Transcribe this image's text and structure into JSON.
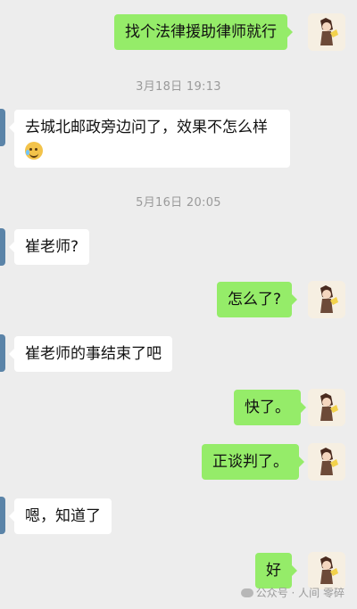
{
  "timestamps": [
    "3月18日 19:13",
    "5月16日 20:05"
  ],
  "messages": [
    {
      "side": "right",
      "text": "找个法律援助律师就行"
    },
    {
      "side": "left",
      "text_line1": "去城北邮政旁边问了，效果不怎么样",
      "emoji": "laughing-crying-emoji"
    },
    {
      "side": "left",
      "text": "崔老师?"
    },
    {
      "side": "right",
      "text": "怎么了?"
    },
    {
      "side": "left",
      "text": "崔老师的事结束了吧"
    },
    {
      "side": "right",
      "text": "快了。"
    },
    {
      "side": "right",
      "text": "正谈判了。"
    },
    {
      "side": "left",
      "text": "嗯，知道了"
    },
    {
      "side": "right",
      "text": "好"
    }
  ],
  "watermark": "公众号 · 人间 零碎",
  "colors": {
    "outgoing": "#95ec69",
    "incoming": "#ffffff",
    "background": "#ededed"
  }
}
